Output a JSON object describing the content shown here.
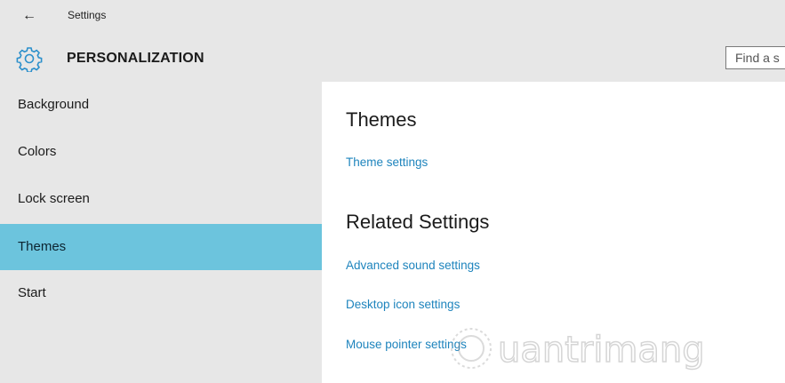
{
  "window": {
    "title": "Settings"
  },
  "header": {
    "section_title": "PERSONALIZATION",
    "search_placeholder": "Find a s"
  },
  "sidebar": {
    "items": [
      {
        "label": "Background"
      },
      {
        "label": "Colors"
      },
      {
        "label": "Lock screen"
      },
      {
        "label": "Themes",
        "selected": true
      },
      {
        "label": "Start"
      }
    ]
  },
  "main": {
    "themes_heading": "Themes",
    "theme_settings_link": "Theme settings",
    "related_heading": "Related Settings",
    "related_links": [
      "Advanced sound settings",
      "Desktop icon settings",
      "Mouse pointer settings"
    ]
  },
  "watermark": {
    "text": "uantrimang"
  },
  "colors": {
    "chrome": "#e7e7e7",
    "selected": "#6cc4dd",
    "link": "#1e84bd",
    "gear": "#2a8fcb"
  },
  "icons": {
    "back": "back-arrow-icon",
    "settings": "gear-icon"
  }
}
